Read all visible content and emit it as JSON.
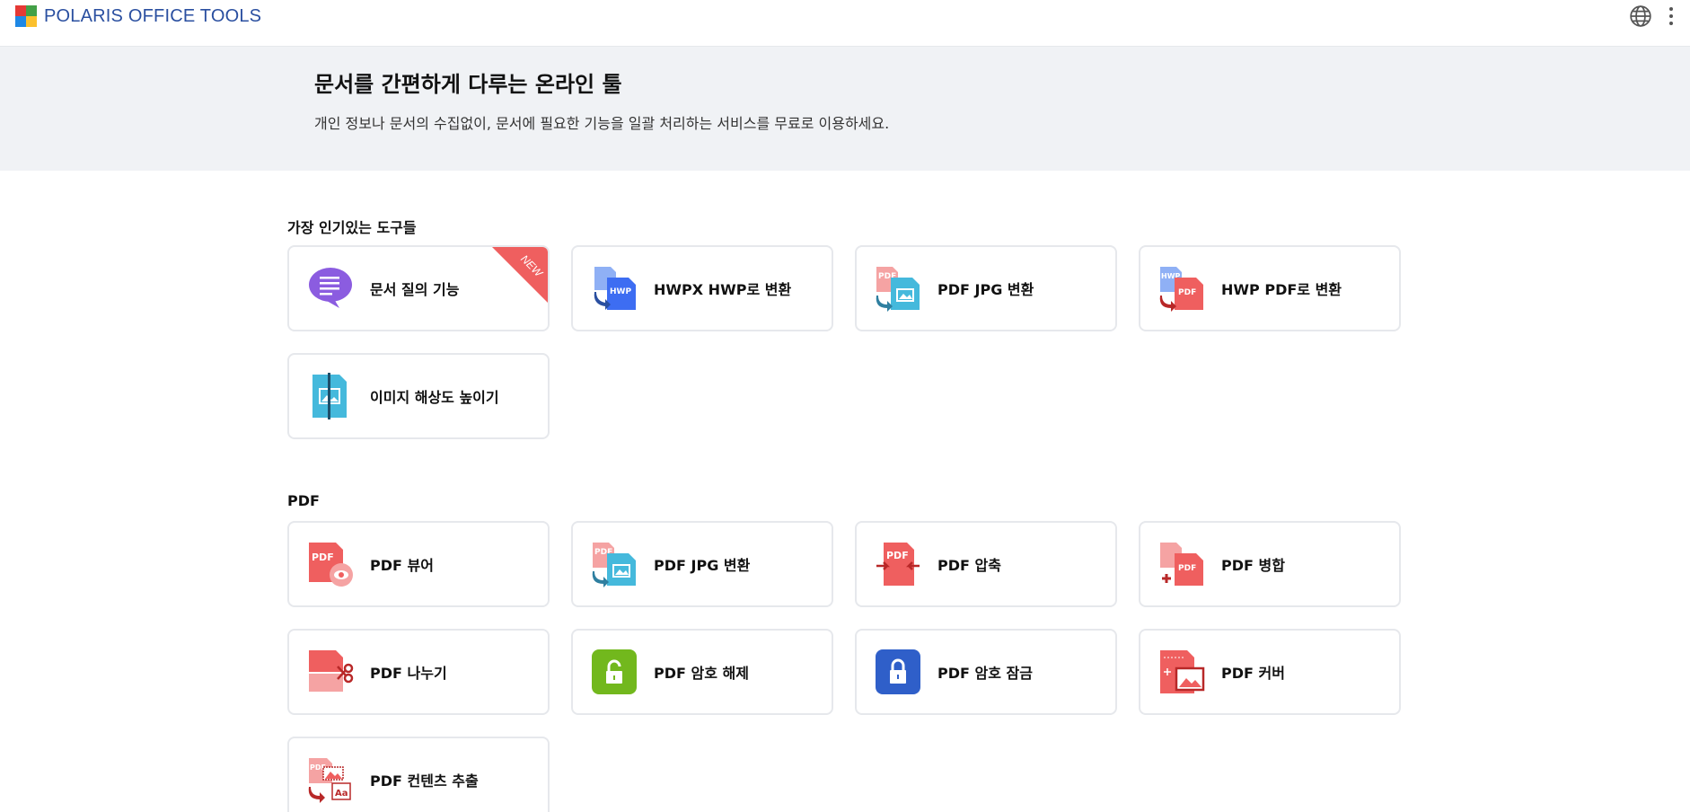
{
  "brand": {
    "name": "POLARIS OFFICE TOOLS",
    "colors": [
      "#e53935",
      "#43a047",
      "#1e88e5",
      "#fbc02d"
    ]
  },
  "header_icons": [
    "globe-icon",
    "more-vertical-icon"
  ],
  "hero": {
    "title": "문서를 간편하게 다루는 온라인 툴",
    "subtitle": "개인 정보나 문서의 수집없이, 문서에 필요한 기능을 일괄 처리하는 서비스를 무료로 이용하세요."
  },
  "popular": {
    "title": "가장 인기있는 도구들",
    "badge": "NEW",
    "items": [
      {
        "label": "문서 질의 기능",
        "icon": "chat-bubble-icon"
      },
      {
        "label": "HWPX HWP로 변환",
        "icon": "hwpx-to-hwp-icon"
      },
      {
        "label": "PDF JPG 변환",
        "icon": "pdf-to-jpg-icon"
      },
      {
        "label": "HWP PDF로 변환",
        "icon": "hwp-to-pdf-icon"
      },
      {
        "label": "이미지 해상도 높이기",
        "icon": "image-upscale-icon"
      }
    ]
  },
  "pdf": {
    "title": "PDF",
    "items": [
      {
        "label": "PDF 뷰어",
        "icon": "pdf-viewer-icon"
      },
      {
        "label": "PDF JPG 변환",
        "icon": "pdf-to-jpg-icon"
      },
      {
        "label": "PDF 압축",
        "icon": "pdf-compress-icon"
      },
      {
        "label": "PDF 병합",
        "icon": "pdf-merge-icon"
      },
      {
        "label": "PDF 나누기",
        "icon": "pdf-split-icon"
      },
      {
        "label": "PDF 암호 해제",
        "icon": "unlock-icon"
      },
      {
        "label": "PDF 암호 잠금",
        "icon": "lock-icon"
      },
      {
        "label": "PDF 커버",
        "icon": "pdf-cover-icon"
      },
      {
        "label": "PDF 컨텐츠 추출",
        "icon": "pdf-extract-icon"
      }
    ]
  },
  "icon_text": {
    "hwp": "HWP",
    "hwpx": "HWP",
    "pdf": "PDF",
    "aa": "Aa"
  }
}
